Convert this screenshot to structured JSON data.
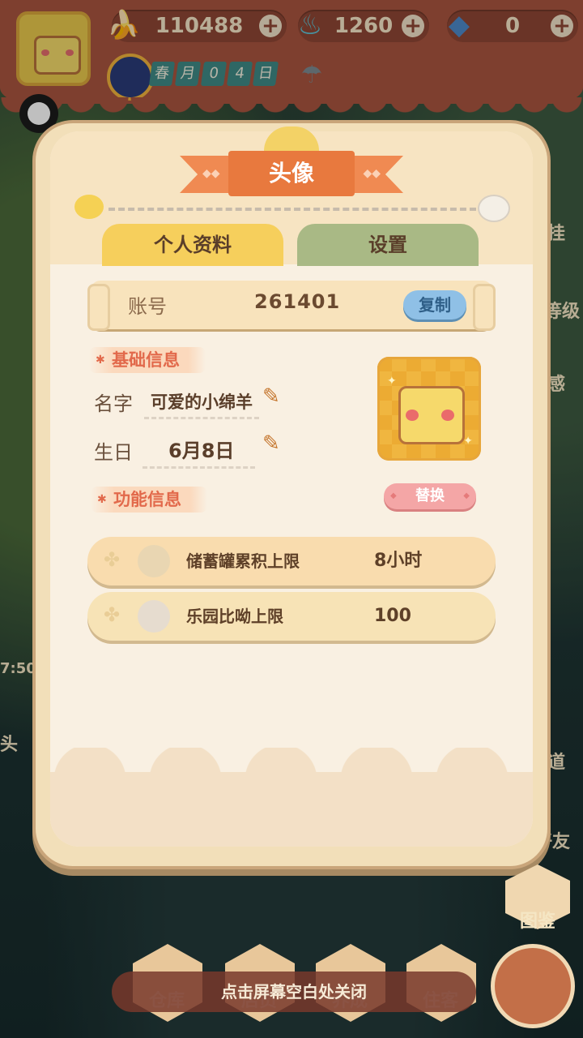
{
  "topbar": {
    "bananas": "110488",
    "fire": "1260",
    "gems": "0",
    "date_chips": [
      "春",
      "月",
      "0",
      "4",
      "日"
    ],
    "icons": {
      "banana": "banana-icon",
      "fire": "fire-icon",
      "gem": "gem-icon",
      "plus": "plus-icon",
      "weather": "rain-cloud-icon",
      "season": "season-clock-icon"
    }
  },
  "side": {
    "left_time": "7:50",
    "left_bottom": "头",
    "right_labels": [
      "挂",
      "等级",
      "感",
      "道",
      "好友"
    ]
  },
  "panel": {
    "title": "头像",
    "tabs": [
      {
        "label": "个人资料",
        "active": true
      },
      {
        "label": "设置",
        "active": false
      }
    ],
    "account": {
      "label": "账号",
      "value": "261401",
      "copy_label": "复制"
    },
    "basic_info": {
      "heading": "基础信息",
      "name_label": "名字",
      "name_value": "可爱的小绵羊",
      "birthday_label": "生日",
      "birthday_value": "6月8日"
    },
    "replace_label": "替换",
    "function_info": {
      "heading": "功能信息",
      "rows": [
        {
          "label": "储蓄罐累积上限",
          "value": "8小时",
          "color": "#f9dcae"
        },
        {
          "label": "乐园比呦上限",
          "value": "100",
          "color": "#f7e3b6"
        }
      ]
    }
  },
  "dock": {
    "items": [
      "仓库",
      "店员",
      "养成",
      "住客"
    ],
    "book_label": "图鉴",
    "close_hint": "点击屏幕空白处关闭"
  },
  "colors": {
    "accent": "#e8793e",
    "topbar": "#a9553f",
    "tab_active": "#f6cf5c",
    "tab_inactive": "#a9b985"
  }
}
